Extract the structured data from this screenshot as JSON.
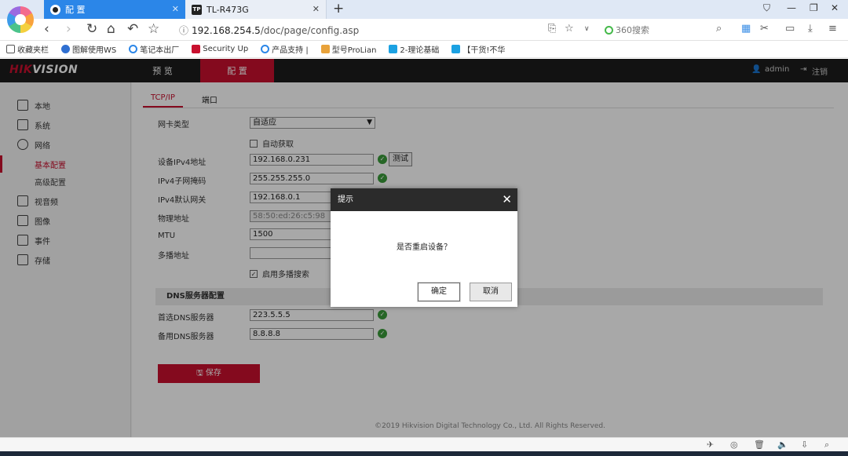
{
  "browser": {
    "tabs": [
      {
        "title": "配 置",
        "active": true
      },
      {
        "title": "TL-R473G",
        "active": false,
        "favicon_text": "TP"
      }
    ],
    "new_tab_glyph": "+",
    "url_host": "192.168.254.5",
    "url_path": "/doc/page/config.asp",
    "search_placeholder": "360搜索",
    "bookmarks": [
      {
        "label": "收藏夹栏",
        "icon": "folder-icon",
        "color": "#555555"
      },
      {
        "label": "图解使用WS",
        "icon": "gear-icon",
        "color": "#2f6fd1"
      },
      {
        "label": "笔记本出厂",
        "icon": "globe-icon",
        "color": "#2b86e8"
      },
      {
        "label": "Security Up",
        "icon": "shield-icon",
        "color": "#c8102e"
      },
      {
        "label": "产品支持 |",
        "icon": "globe-icon",
        "color": "#2b86e8"
      },
      {
        "label": "型号ProLian",
        "icon": "server-icon",
        "color": "#e8a23a"
      },
      {
        "label": "2-理论基础",
        "icon": "bookmark-icon",
        "color": "#1ba1e2"
      },
      {
        "label": "【干货!不华",
        "icon": "bookmark-icon",
        "color": "#1ba1e2"
      }
    ]
  },
  "app": {
    "logo_red": "HIK",
    "logo_white": "VISION",
    "nav": [
      {
        "label": "预 览",
        "active": false
      },
      {
        "label": "配 置",
        "active": true
      }
    ],
    "user": "admin",
    "logout": "注销",
    "sidebar": [
      {
        "label": "本地",
        "icon": "monitor-icon",
        "type": "main"
      },
      {
        "label": "系统",
        "icon": "system-icon",
        "type": "main"
      },
      {
        "label": "网络",
        "icon": "globe-icon",
        "type": "main"
      },
      {
        "label": "基本配置",
        "type": "sub",
        "active": true
      },
      {
        "label": "高级配置",
        "type": "sub",
        "active": false
      },
      {
        "label": "视音频",
        "icon": "video-icon",
        "type": "main"
      },
      {
        "label": "图像",
        "icon": "image-icon",
        "type": "main"
      },
      {
        "label": "事件",
        "icon": "calendar-icon",
        "type": "main"
      },
      {
        "label": "存储",
        "icon": "storage-icon",
        "type": "main"
      }
    ],
    "tabs": [
      {
        "label": "TCP/IP",
        "active": true
      },
      {
        "label": "端口",
        "active": false
      }
    ],
    "form": {
      "nic_type_label": "网卡类型",
      "nic_type_value": "自适应",
      "dhcp_label": "自动获取",
      "dhcp_checked": false,
      "ipv4_label": "设备IPv4地址",
      "ipv4_value": "192.168.0.231",
      "test_button": "测试",
      "mask_label": "IPv4子网掩码",
      "mask_value": "255.255.255.0",
      "gateway_label": "IPv4默认网关",
      "gateway_value": "192.168.0.1",
      "mac_label": "物理地址",
      "mac_value": "58:50:ed:26:c5:98",
      "mtu_label": "MTU",
      "mtu_value": "1500",
      "multicast_label": "多播地址",
      "multicast_value": "",
      "multicast_search_label": "启用多播搜索",
      "multicast_search_checked": true,
      "dns_section": "DNS服务器配置",
      "dns1_label": "首选DNS服务器",
      "dns1_value": "223.5.5.5",
      "dns2_label": "备用DNS服务器",
      "dns2_value": "8.8.8.8",
      "save_button": "保存"
    },
    "copyright": "©2019 Hikvision Digital Technology Co., Ltd. All Rights Reserved."
  },
  "dialog": {
    "title": "提示",
    "message": "是否重启设备？",
    "confirm": "确定",
    "cancel": "取消"
  },
  "colors": {
    "accent_red": "#c8102e",
    "tab_blue": "#2b86e8",
    "ok_green": "#3a9c3a"
  }
}
